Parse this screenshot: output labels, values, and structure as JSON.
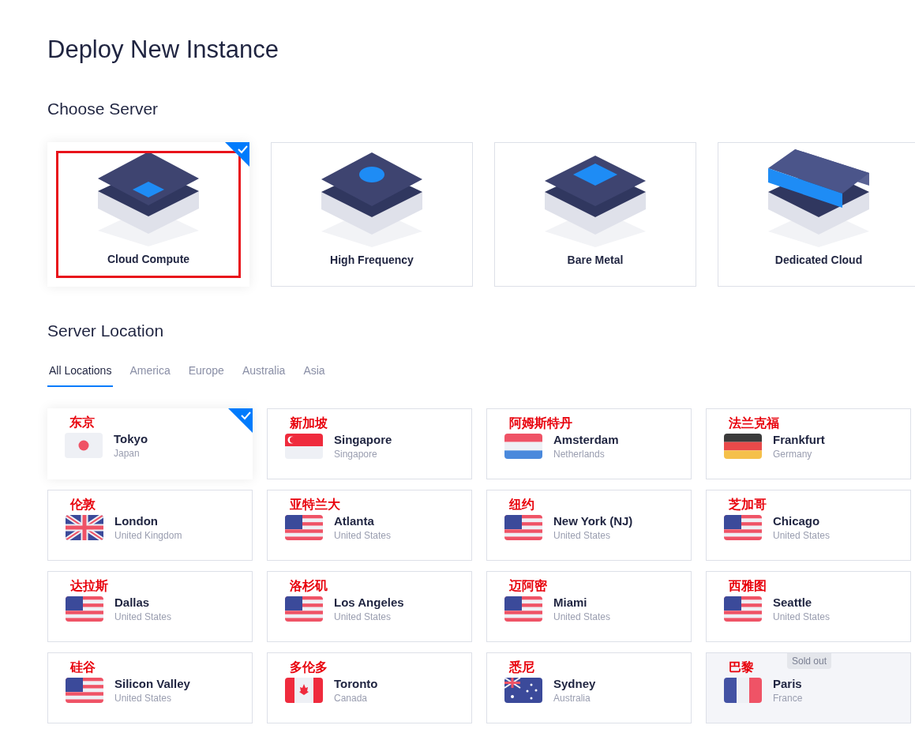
{
  "page_title": "Deploy New Instance",
  "server_section": {
    "heading": "Choose Server",
    "servers": [
      {
        "label": "Cloud Compute",
        "kind": "compute",
        "selected": true,
        "highlighted": true
      },
      {
        "label": "High Frequency",
        "kind": "frequency",
        "selected": false,
        "highlighted": false
      },
      {
        "label": "Bare Metal",
        "kind": "metal",
        "selected": false,
        "highlighted": false
      },
      {
        "label": "Dedicated Cloud",
        "kind": "dedicated",
        "selected": false,
        "highlighted": false
      }
    ]
  },
  "location_section": {
    "heading": "Server Location",
    "tabs": [
      {
        "label": "All Locations",
        "selected": true
      },
      {
        "label": "America",
        "selected": false
      },
      {
        "label": "Europe",
        "selected": false
      },
      {
        "label": "Australia",
        "selected": false
      },
      {
        "label": "Asia",
        "selected": false
      }
    ],
    "locations": [
      {
        "annotation": "东京",
        "city": "Tokyo",
        "country": "Japan",
        "kind": "jp",
        "selected": true
      },
      {
        "annotation": "新加坡",
        "city": "Singapore",
        "country": "Singapore",
        "kind": "sg",
        "selected": false
      },
      {
        "annotation": "阿姆斯特丹",
        "city": "Amsterdam",
        "country": "Netherlands",
        "kind": "nl",
        "selected": false
      },
      {
        "annotation": "法兰克福",
        "city": "Frankfurt",
        "country": "Germany",
        "kind": "de",
        "selected": false
      },
      {
        "annotation": "伦敦",
        "city": "London",
        "country": "United Kingdom",
        "kind": "gb",
        "selected": false
      },
      {
        "annotation": "亚特兰大",
        "city": "Atlanta",
        "country": "United States",
        "kind": "us",
        "selected": false
      },
      {
        "annotation": "纽约",
        "city": "New York (NJ)",
        "country": "United States",
        "kind": "us",
        "selected": false
      },
      {
        "annotation": "芝加哥",
        "city": "Chicago",
        "country": "United States",
        "kind": "us",
        "selected": false
      },
      {
        "annotation": "达拉斯",
        "city": "Dallas",
        "country": "United States",
        "kind": "us",
        "selected": false
      },
      {
        "annotation": "洛杉矶",
        "city": "Los Angeles",
        "country": "United States",
        "kind": "us",
        "selected": false
      },
      {
        "annotation": "迈阿密",
        "city": "Miami",
        "country": "United States",
        "kind": "us",
        "selected": false
      },
      {
        "annotation": "西雅图",
        "city": "Seattle",
        "country": "United States",
        "kind": "us",
        "selected": false
      },
      {
        "annotation": "硅谷",
        "city": "Silicon Valley",
        "country": "United States",
        "kind": "us",
        "selected": false
      },
      {
        "annotation": "多伦多",
        "city": "Toronto",
        "country": "Canada",
        "kind": "ca",
        "selected": false
      },
      {
        "annotation": "悉尼",
        "city": "Sydney",
        "country": "Australia",
        "kind": "au",
        "selected": false
      },
      {
        "annotation": "巴黎",
        "city": "Paris",
        "country": "France",
        "kind": "fr",
        "selected": false,
        "badge": "Sold out"
      }
    ]
  }
}
